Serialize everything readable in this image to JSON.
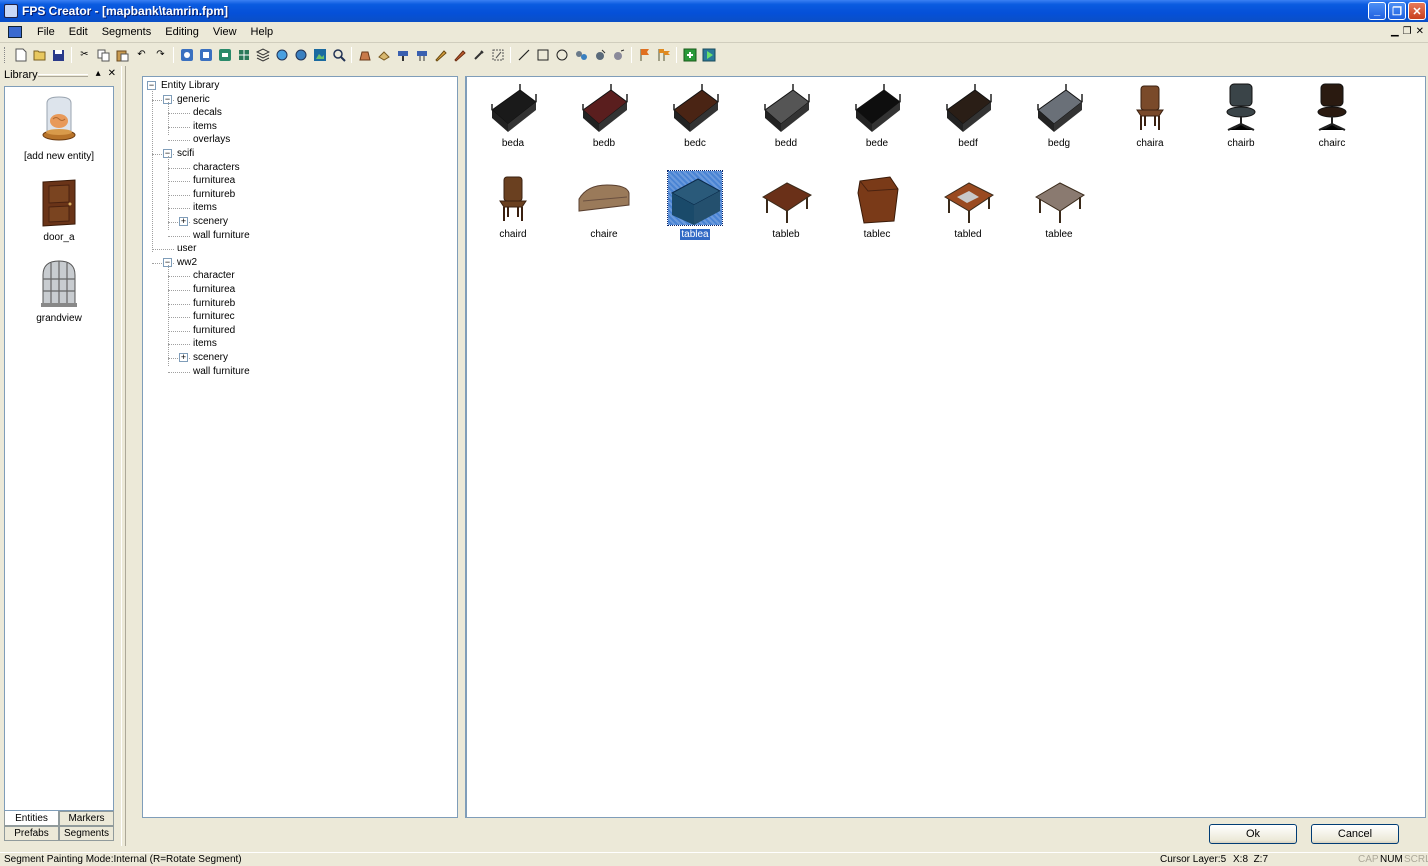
{
  "window": {
    "title": "FPS Creator - [mapbank\\tamrin.fpm]"
  },
  "menu": {
    "items": [
      "File",
      "Edit",
      "Segments",
      "Editing",
      "View",
      "Help"
    ]
  },
  "library": {
    "header": "Library",
    "entries": [
      {
        "label": "[add new entity]",
        "icon": "brain-jar-icon"
      },
      {
        "label": "door_a",
        "icon": "door-icon"
      },
      {
        "label": "grandview",
        "icon": "window-icon"
      }
    ],
    "tabs": {
      "entities": "Entities",
      "markers": "Markers",
      "prefabs": "Prefabs",
      "segments": "Segments"
    }
  },
  "tree": {
    "root": "Entity Library",
    "nodes": [
      {
        "label": "generic",
        "level": 1,
        "expander": "-"
      },
      {
        "label": "decals",
        "level": 2
      },
      {
        "label": "items",
        "level": 2
      },
      {
        "label": "overlays",
        "level": 2
      },
      {
        "label": "scifi",
        "level": 1,
        "expander": "-"
      },
      {
        "label": "characters",
        "level": 2
      },
      {
        "label": "furniturea",
        "level": 2
      },
      {
        "label": "furnitureb",
        "level": 2
      },
      {
        "label": "items",
        "level": 2
      },
      {
        "label": "scenery",
        "level": 2,
        "expander": "+"
      },
      {
        "label": "wall furniture",
        "level": 2
      },
      {
        "label": "user",
        "level": 1
      },
      {
        "label": "ww2",
        "level": 1,
        "expander": "-"
      },
      {
        "label": "character",
        "level": 2
      },
      {
        "label": "furniturea",
        "level": 2
      },
      {
        "label": "furnitureb",
        "level": 2
      },
      {
        "label": "furniturec",
        "level": 2
      },
      {
        "label": "furnitured",
        "level": 2
      },
      {
        "label": "items",
        "level": 2
      },
      {
        "label": "scenery",
        "level": 2,
        "expander": "+"
      },
      {
        "label": "wall furniture",
        "level": 2
      }
    ]
  },
  "gallery": {
    "items": [
      {
        "label": "beda",
        "kind": "bed",
        "color": "#1a1a1a"
      },
      {
        "label": "bedb",
        "kind": "bed",
        "color": "#5a1e1e"
      },
      {
        "label": "bedc",
        "kind": "bed",
        "color": "#4a2414"
      },
      {
        "label": "bedd",
        "kind": "bed",
        "color": "#555555"
      },
      {
        "label": "bede",
        "kind": "bed",
        "color": "#0e0e0e"
      },
      {
        "label": "bedf",
        "kind": "bed",
        "color": "#2a1e16"
      },
      {
        "label": "bedg",
        "kind": "bed",
        "color": "#6a7078"
      },
      {
        "label": "chaira",
        "kind": "chair",
        "color": "#7a4a2a"
      },
      {
        "label": "chairb",
        "kind": "officechair",
        "color": "#3a4448"
      },
      {
        "label": "chairc",
        "kind": "officechair",
        "color": "#2a1a10"
      },
      {
        "label": "chaird",
        "kind": "chair",
        "color": "#6a4020"
      },
      {
        "label": "chaire",
        "kind": "sofa",
        "color": "#9a7a5a"
      },
      {
        "label": "tablea",
        "kind": "desk",
        "color": "#2a5a7a",
        "selected": true
      },
      {
        "label": "tableb",
        "kind": "table",
        "color": "#6a3018"
      },
      {
        "label": "tablec",
        "kind": "cabinet",
        "color": "#7a3a18"
      },
      {
        "label": "tabled",
        "kind": "table",
        "color": "#9a4a20"
      },
      {
        "label": "tablee",
        "kind": "table",
        "color": "#8a7a70"
      }
    ]
  },
  "buttons": {
    "ok": "Ok",
    "cancel": "Cancel"
  },
  "status": {
    "mode": "Segment Painting Mode:Internal (R=Rotate Segment)",
    "cursor_layer": "Cursor Layer:5",
    "coords": "X:8  Z:7",
    "cap": "CAP",
    "num": "NUM",
    "scrl": "SCRL"
  }
}
